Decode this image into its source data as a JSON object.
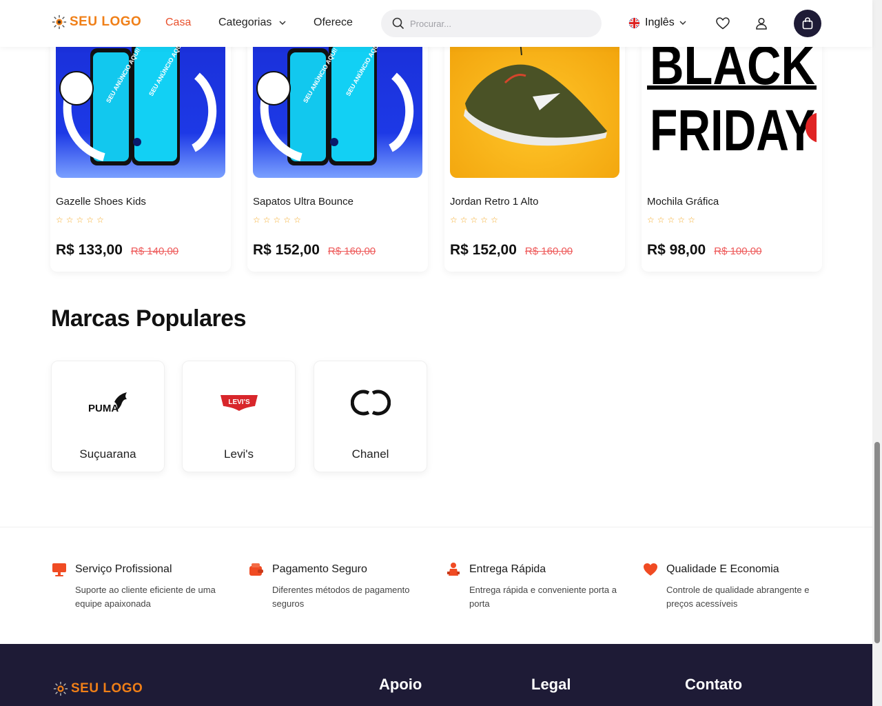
{
  "header": {
    "logo_text": "SEU LOGO",
    "nav": [
      {
        "label": "Casa",
        "active": true
      },
      {
        "label": "Categorias",
        "has_dropdown": true
      },
      {
        "label": "Oferece"
      }
    ],
    "search_placeholder": "Procurar...",
    "language": "Inglês",
    "icons": [
      "search-icon",
      "uk-flag-icon",
      "heart-icon",
      "user-icon",
      "shopping-bag-icon"
    ]
  },
  "products": [
    {
      "name": "Gazelle Shoes Kids",
      "price": "R$ 133,00",
      "old_price": "R$ 140,00",
      "rating": 0
    },
    {
      "name": "Sapatos Ultra Bounce",
      "price": "R$ 152,00",
      "old_price": "R$ 160,00",
      "rating": 0
    },
    {
      "name": "Jordan Retro 1 Alto",
      "price": "R$ 152,00",
      "old_price": "R$ 160,00",
      "rating": 0
    },
    {
      "name": "Mochila Gráfica",
      "price": "R$ 98,00",
      "old_price": "R$ 100,00",
      "rating": 0
    }
  ],
  "product_images": [
    {
      "texts": [
        "SEU ANÚNCIO AQUI!",
        "SEU ANÚNCIO AQUI!"
      ]
    },
    {
      "texts": [
        "SEU ANÚNCIO AQUI!",
        "SEU ANÚNCIO AQUI!"
      ]
    },
    {
      "texts": []
    },
    {
      "texts": [
        "BLACK",
        "FRIDAY"
      ]
    }
  ],
  "brands_section": {
    "title": "Marcas Populares",
    "brands": [
      {
        "name": "Suçuarana",
        "logo_text": "PUMA"
      },
      {
        "name": "Levi's",
        "logo_text": "LEVI'S"
      },
      {
        "name": "Chanel",
        "logo_text": "CC"
      }
    ]
  },
  "features": [
    {
      "title": "Serviço Profissional",
      "desc": "Suporte ao cliente eficiente de uma equipe apaixonada",
      "icon": "monitor-icon"
    },
    {
      "title": "Pagamento Seguro",
      "desc": "Diferentes métodos de pagamento seguros",
      "icon": "wallet-icon"
    },
    {
      "title": "Entrega Rápida",
      "desc": "Entrega rápida e conveniente porta a porta",
      "icon": "delivery-icon"
    },
    {
      "title": "Qualidade E Economia",
      "desc": "Controle de qualidade abrangente e preços acessíveis",
      "icon": "heart-icon"
    }
  ],
  "footer": {
    "logo_text": "SEU LOGO",
    "columns": [
      "Apoio",
      "Legal",
      "Contato"
    ]
  },
  "colors": {
    "accent": "#e8502c",
    "logo": "#f07f17",
    "dark": "#1e1b36",
    "old_price": "#ee5a5a",
    "star": "#f4a823"
  }
}
